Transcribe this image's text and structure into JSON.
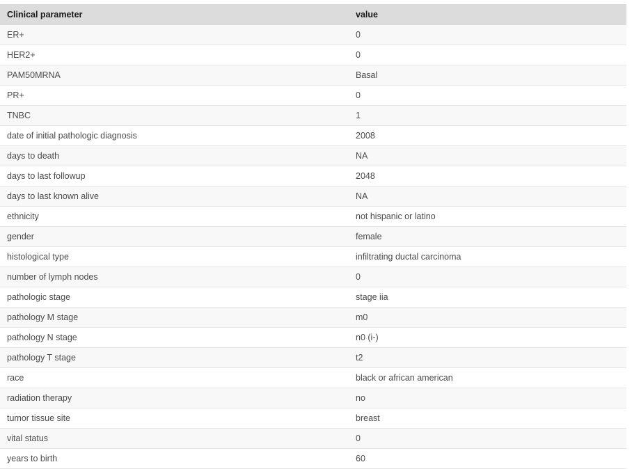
{
  "table": {
    "columns": [
      {
        "key": "parameter",
        "label": "Clinical parameter"
      },
      {
        "key": "value",
        "label": "value"
      }
    ],
    "header_background": "#dcdcdc",
    "stripe_background": "#f8f8f8",
    "row_background": "#ffffff",
    "border_color": "#e6e6e6",
    "text_color": "#4b4b4b",
    "header_text_color": "#1a1a1a",
    "rows": [
      {
        "parameter": "ER+",
        "value": "0"
      },
      {
        "parameter": "HER2+",
        "value": "0"
      },
      {
        "parameter": "PAM50MRNA",
        "value": "Basal"
      },
      {
        "parameter": "PR+",
        "value": "0"
      },
      {
        "parameter": "TNBC",
        "value": "1"
      },
      {
        "parameter": "date of initial pathologic diagnosis",
        "value": "2008"
      },
      {
        "parameter": "days to death",
        "value": "NA"
      },
      {
        "parameter": "days to last followup",
        "value": "2048"
      },
      {
        "parameter": "days to last known alive",
        "value": "NA"
      },
      {
        "parameter": "ethnicity",
        "value": "not hispanic or latino"
      },
      {
        "parameter": "gender",
        "value": "female"
      },
      {
        "parameter": "histological type",
        "value": "infiltrating ductal carcinoma"
      },
      {
        "parameter": "number of lymph nodes",
        "value": "0"
      },
      {
        "parameter": "pathologic stage",
        "value": "stage iia"
      },
      {
        "parameter": "pathology M stage",
        "value": "m0"
      },
      {
        "parameter": "pathology N stage",
        "value": "n0 (i-)"
      },
      {
        "parameter": "pathology T stage",
        "value": "t2"
      },
      {
        "parameter": "race",
        "value": "black or african american"
      },
      {
        "parameter": "radiation therapy",
        "value": "no"
      },
      {
        "parameter": "tumor tissue site",
        "value": "breast"
      },
      {
        "parameter": "vital status",
        "value": "0"
      },
      {
        "parameter": "years to birth",
        "value": "60"
      }
    ]
  }
}
